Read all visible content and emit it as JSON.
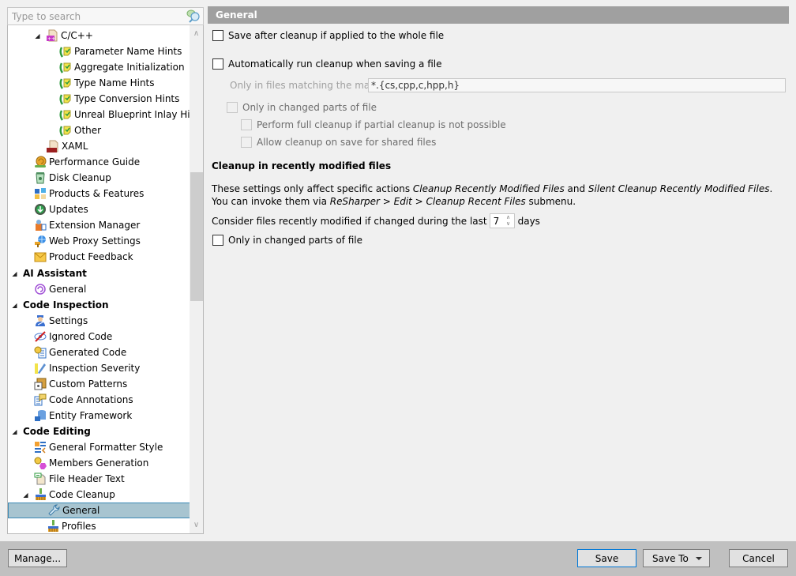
{
  "search": {
    "placeholder": "Type to search"
  },
  "tree": {
    "items": [
      {
        "label": "C/C++",
        "level": 2,
        "expanded": true,
        "icon": "cpp-file-icon"
      },
      {
        "label": "Parameter Name Hints",
        "level": 3,
        "icon": "inlay-hint-icon"
      },
      {
        "label": "Aggregate Initialization",
        "level": 3,
        "icon": "inlay-hint-icon"
      },
      {
        "label": "Type Name Hints",
        "level": 3,
        "icon": "inlay-hint-icon"
      },
      {
        "label": "Type Conversion Hints",
        "level": 3,
        "icon": "inlay-hint-icon"
      },
      {
        "label": "Unreal Blueprint Inlay Hints",
        "level": 3,
        "icon": "inlay-hint-icon"
      },
      {
        "label": "Other",
        "level": 3,
        "icon": "inlay-hint-icon"
      },
      {
        "label": "XAML",
        "level": 2,
        "icon": "xaml-file-icon"
      },
      {
        "label": "Performance Guide",
        "level": 1,
        "icon": "snail-icon"
      },
      {
        "label": "Disk Cleanup",
        "level": 1,
        "icon": "recycle-bin-icon"
      },
      {
        "label": "Products & Features",
        "level": 1,
        "icon": "products-grid-icon"
      },
      {
        "label": "Updates",
        "level": 1,
        "icon": "update-download-icon"
      },
      {
        "label": "Extension Manager",
        "level": 1,
        "icon": "extension-manager-icon"
      },
      {
        "label": "Web Proxy Settings",
        "level": 1,
        "icon": "web-proxy-icon"
      },
      {
        "label": "Product Feedback",
        "level": 1,
        "icon": "envelope-icon"
      },
      {
        "label": "AI Assistant",
        "level": 0,
        "section": true,
        "expanded": true
      },
      {
        "label": "General",
        "level": 1,
        "icon": "ai-spiral-icon"
      },
      {
        "label": "Code Inspection",
        "level": 0,
        "section": true,
        "expanded": true
      },
      {
        "label": "Settings",
        "level": 1,
        "icon": "inspector-person-icon"
      },
      {
        "label": "Ignored Code",
        "level": 1,
        "icon": "ignored-eye-icon"
      },
      {
        "label": "Generated Code",
        "level": 1,
        "icon": "generated-code-icon"
      },
      {
        "label": "Inspection Severity",
        "level": 1,
        "icon": "severity-marker-icon"
      },
      {
        "label": "Custom Patterns",
        "level": 1,
        "icon": "custom-patterns-icon"
      },
      {
        "label": "Code Annotations",
        "level": 1,
        "icon": "code-annotations-icon"
      },
      {
        "label": "Entity Framework",
        "level": 1,
        "icon": "entity-framework-icon"
      },
      {
        "label": "Code Editing",
        "level": 0,
        "section": true,
        "expanded": true
      },
      {
        "label": "General Formatter Style",
        "level": 1,
        "icon": "formatter-style-icon"
      },
      {
        "label": "Members Generation",
        "level": 1,
        "icon": "members-generation-icon"
      },
      {
        "label": "File Header Text",
        "level": 1,
        "icon": "file-header-icon"
      },
      {
        "label": "Code Cleanup",
        "level": 1,
        "expanded": true,
        "icon": "broom-icon"
      },
      {
        "label": "General",
        "level": 2,
        "selected": true,
        "icon": "wrench-icon"
      },
      {
        "label": "Profiles",
        "level": 2,
        "icon": "broom-icon"
      }
    ]
  },
  "page": {
    "title": "General",
    "save_after_cleanup": {
      "label": "Save after cleanup if applied to the whole file",
      "checked": false
    },
    "auto_run_on_save": {
      "label": "Automatically run cleanup when saving a file",
      "checked": false
    },
    "mask_label": "Only in files matching the mask",
    "mask_value": "*.{cs,cpp,c,hpp,h}",
    "only_changed_parts": {
      "label": "Only in changed parts of file",
      "checked": false,
      "disabled": true
    },
    "full_cleanup_if_partial_impossible": {
      "label": "Perform full cleanup if partial cleanup is not possible",
      "checked": false,
      "disabled": true
    },
    "allow_shared_files": {
      "label": "Allow cleanup on save for shared files",
      "checked": false,
      "disabled": true
    },
    "recent_section_title": "Cleanup in recently modified files",
    "recent_desc": {
      "t1": "These settings only affect specific actions ",
      "i1": "Cleanup Recently Modified Files",
      "t2": " and ",
      "i2": "Silent Cleanup Recently Modified Files",
      "t3": ". You can invoke them via ",
      "i3": "ReSharper > Edit > Cleanup Recent Files",
      "t4": " submenu."
    },
    "days_prefix": "Consider files recently modified if changed during the last",
    "days_value": "7",
    "days_suffix": "days",
    "recent_only_changed": {
      "label": "Only in changed parts of file",
      "checked": false
    }
  },
  "footer": {
    "manage_label": "Manage...",
    "save_label": "Save",
    "save_to_label": "Save To",
    "cancel_label": "Cancel"
  }
}
